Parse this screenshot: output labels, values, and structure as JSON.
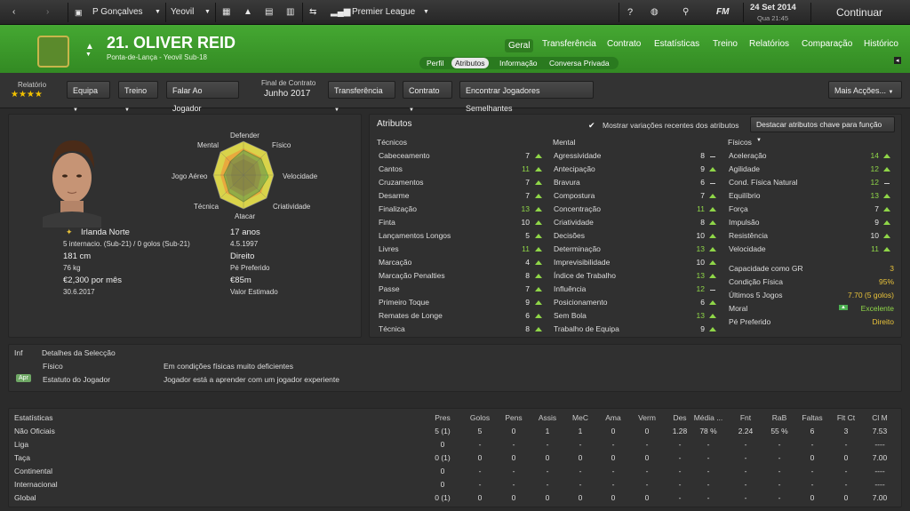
{
  "topbar": {
    "manager": "P Gonçalves",
    "club": "Yeovil",
    "competition": "Premier League",
    "date": "24 Set 2014",
    "time": "Qua 21:45",
    "continue_label": "Continuar",
    "fm_label": "FM"
  },
  "player": {
    "name": "21. OLIVER REID",
    "subtitle": "Ponta-de-Lança - Yeovil Sub-18",
    "nationality": "Irlanda Norte",
    "caps": "5 internacio. (Sub-21) / 0 golos (Sub-21)",
    "height": "181 cm",
    "weight": "76 kg",
    "wage": "€2,300 por mês",
    "contract_date": "30.6.2017",
    "age": "17 anos",
    "dob": "4.5.1997",
    "foot": "Direito",
    "foot_label": "Pé Preferido",
    "value": "€85m",
    "value_label": "Valor Estimado"
  },
  "main_tabs": [
    "Geral",
    "Transferência",
    "Contrato",
    "Estatísticas",
    "Treino",
    "Relatórios",
    "Comparação",
    "Histórico"
  ],
  "sub_tabs": [
    "Perfil",
    "Atributos",
    "Informação",
    "Conversa Privada"
  ],
  "toolbar": {
    "report_label": "Relatório",
    "stars": "★★★★",
    "equipa": "Equipa",
    "treino": "Treino",
    "falar": "Falar Ao Jogador",
    "contract_end_label": "Final de Contrato",
    "contract_end": "Junho 2017",
    "transferencia": "Transferência",
    "contrato": "Contrato",
    "similar": "Encontrar Jogadores Semelhantes",
    "more": "Mais Acções..."
  },
  "radar": {
    "labels": [
      "Defender",
      "Físico",
      "Velocidade",
      "Criatividade",
      "Atacar",
      "Técnica",
      "Jogo Aéreo",
      "Mental"
    ]
  },
  "attributes": {
    "title": "Atributos",
    "show_variations": "Mostrar variações recentes dos atributos",
    "highlight": "Destacar atributos chave para função",
    "technical_title": "Técnicos",
    "mental_title": "Mental",
    "physical_title": "Físicos",
    "technical": [
      {
        "name": "Cabeceamento",
        "value": "7",
        "trend": "up"
      },
      {
        "name": "Cantos",
        "value": "11",
        "trend": "up"
      },
      {
        "name": "Cruzamentos",
        "value": "7",
        "trend": "up"
      },
      {
        "name": "Desarme",
        "value": "7",
        "trend": "up"
      },
      {
        "name": "Finalização",
        "value": "13",
        "trend": "up"
      },
      {
        "name": "Finta",
        "value": "10",
        "trend": "up"
      },
      {
        "name": "Lançamentos Longos",
        "value": "5",
        "trend": "up"
      },
      {
        "name": "Livres",
        "value": "11",
        "trend": "up"
      },
      {
        "name": "Marcação",
        "value": "4",
        "trend": "up"
      },
      {
        "name": "Marcação Penalties",
        "value": "8",
        "trend": "up"
      },
      {
        "name": "Passe",
        "value": "7",
        "trend": "up"
      },
      {
        "name": "Primeiro Toque",
        "value": "9",
        "trend": "up"
      },
      {
        "name": "Remates de Longe",
        "value": "6",
        "trend": "up"
      },
      {
        "name": "Técnica",
        "value": "8",
        "trend": "up"
      }
    ],
    "mental": [
      {
        "name": "Agressividade",
        "value": "8",
        "trend": "flat"
      },
      {
        "name": "Antecipação",
        "value": "9",
        "trend": "up"
      },
      {
        "name": "Bravura",
        "value": "6",
        "trend": "flat"
      },
      {
        "name": "Compostura",
        "value": "7",
        "trend": "up"
      },
      {
        "name": "Concentração",
        "value": "11",
        "trend": "up"
      },
      {
        "name": "Criatividade",
        "value": "8",
        "trend": "up"
      },
      {
        "name": "Decisões",
        "value": "10",
        "trend": "up"
      },
      {
        "name": "Determinação",
        "value": "13",
        "trend": "up"
      },
      {
        "name": "Imprevisibilidade",
        "value": "10",
        "trend": "up"
      },
      {
        "name": "Índice de Trabalho",
        "value": "13",
        "trend": "up"
      },
      {
        "name": "Influência",
        "value": "12",
        "trend": "flat"
      },
      {
        "name": "Posicionamento",
        "value": "6",
        "trend": "up"
      },
      {
        "name": "Sem Bola",
        "value": "13",
        "trend": "up"
      },
      {
        "name": "Trabalho de Equipa",
        "value": "9",
        "trend": "up"
      }
    ],
    "physical": [
      {
        "name": "Aceleração",
        "value": "14",
        "trend": "up"
      },
      {
        "name": "Agilidade",
        "value": "12",
        "trend": "up"
      },
      {
        "name": "Cond. Física Natural",
        "value": "12",
        "trend": "flat"
      },
      {
        "name": "Equilíbrio",
        "value": "13",
        "trend": "up"
      },
      {
        "name": "Força",
        "value": "7",
        "trend": "up"
      },
      {
        "name": "Impulsão",
        "value": "9",
        "trend": "up"
      },
      {
        "name": "Resistência",
        "value": "10",
        "trend": "up"
      },
      {
        "name": "Velocidade",
        "value": "11",
        "trend": "up"
      }
    ],
    "extra": [
      {
        "name": "Capacidade como GR",
        "value": "3"
      },
      {
        "name": "Condição Física",
        "value": "95%"
      },
      {
        "name": "Últimos 5 Jogos",
        "value": "7.70 (5 golos)"
      },
      {
        "name": "Moral",
        "value": "Excelente"
      },
      {
        "name": "Pé Preferido",
        "value": "Direito"
      }
    ]
  },
  "selection": {
    "inf": "Inf",
    "title": "Detalhes da Selecção",
    "rows": [
      {
        "badge": "",
        "label": "Físico",
        "value": "Em condições físicas muito deficientes"
      },
      {
        "badge": "Apr",
        "label": "Estatuto do Jogador",
        "value": "Jogador está a aprender com um jogador experiente"
      }
    ]
  },
  "stats": {
    "title": "Estatísticas",
    "columns": [
      "Pres",
      "Golos",
      "Pens",
      "Assis",
      "MeC",
      "Ama",
      "Verm",
      "Des",
      "Média ...",
      "Fnt",
      "RaB",
      "Faltas",
      "Flt Ct",
      "Cl M"
    ],
    "rows": [
      {
        "label": "Não Oficiais",
        "values": [
          "5 (1)",
          "5",
          "0",
          "1",
          "1",
          "0",
          "0",
          "1.28",
          "78 %",
          "2.24",
          "55 %",
          "6",
          "3",
          "7.53"
        ]
      },
      {
        "label": "Liga",
        "values": [
          "0",
          "-",
          "-",
          "-",
          "-",
          "-",
          "-",
          "-",
          "-",
          "-",
          "-",
          "-",
          "-",
          "----"
        ]
      },
      {
        "label": "Taça",
        "values": [
          "0 (1)",
          "0",
          "0",
          "0",
          "0",
          "0",
          "0",
          "-",
          "-",
          "-",
          "-",
          "0",
          "0",
          "7.00"
        ]
      },
      {
        "label": "Continental",
        "values": [
          "0",
          "-",
          "-",
          "-",
          "-",
          "-",
          "-",
          "-",
          "-",
          "-",
          "-",
          "-",
          "-",
          "----"
        ]
      },
      {
        "label": "Internacional",
        "values": [
          "0",
          "-",
          "-",
          "-",
          "-",
          "-",
          "-",
          "-",
          "-",
          "-",
          "-",
          "-",
          "-",
          "----"
        ]
      },
      {
        "label": "Global",
        "values": [
          "0 (1)",
          "0",
          "0",
          "0",
          "0",
          "0",
          "0",
          "-",
          "-",
          "-",
          "-",
          "0",
          "0",
          "7.00"
        ]
      }
    ]
  }
}
